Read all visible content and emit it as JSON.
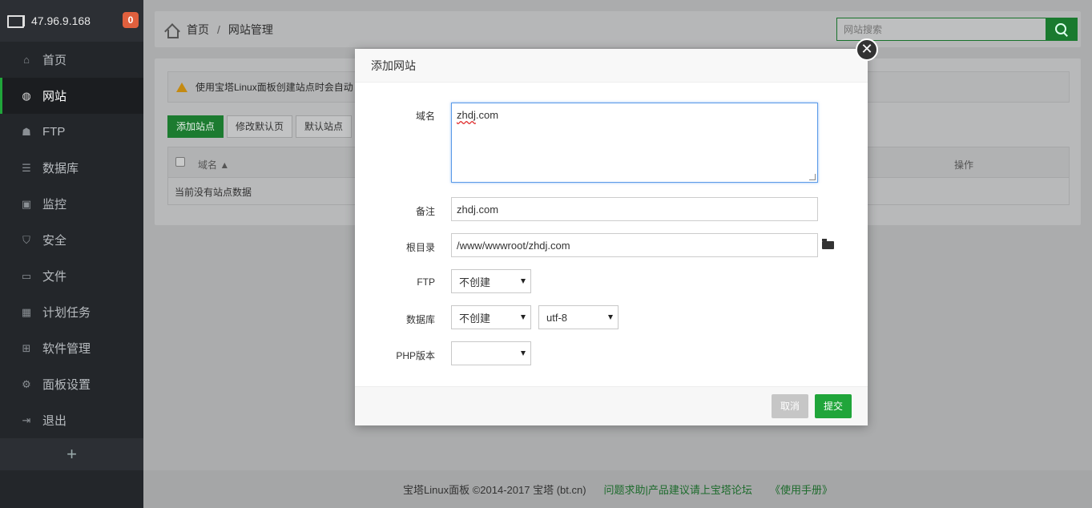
{
  "sidebar": {
    "ip": "47.96.9.168",
    "badge": "0",
    "items": [
      {
        "label": "首页",
        "icon": "home-icon"
      },
      {
        "label": "网站",
        "icon": "globe-icon"
      },
      {
        "label": "FTP",
        "icon": "ftp-icon"
      },
      {
        "label": "数据库",
        "icon": "database-icon"
      },
      {
        "label": "监控",
        "icon": "monitor-icon"
      },
      {
        "label": "安全",
        "icon": "shield-icon"
      },
      {
        "label": "文件",
        "icon": "folder-icon"
      },
      {
        "label": "计划任务",
        "icon": "calendar-icon"
      },
      {
        "label": "软件管理",
        "icon": "grid-icon"
      },
      {
        "label": "面板设置",
        "icon": "gear-icon"
      },
      {
        "label": "退出",
        "icon": "logout-icon"
      }
    ],
    "add": "+"
  },
  "header": {
    "breadcrumb_home": "首页",
    "breadcrumb_sep": "/",
    "breadcrumb_current": "网站管理",
    "search_placeholder": "网站搜索"
  },
  "panel": {
    "warning": "使用宝塔Linux面板创建站点时会自动",
    "buttons": {
      "add_site": "添加站点",
      "modify_default": "修改默认页",
      "default_site": "默认站点"
    },
    "table": {
      "col_domain": "域名 ▲",
      "col_ops": "操作",
      "empty": "当前没有站点数据"
    }
  },
  "footer": {
    "copyright": "宝塔Linux面板 ©2014-2017 宝塔 (bt.cn)",
    "forum_link": "问题求助|产品建议请上宝塔论坛",
    "manual_link": "《使用手册》"
  },
  "modal": {
    "title": "添加网站",
    "close": "✕",
    "labels": {
      "domain": "域名",
      "remark": "备注",
      "root": "根目录",
      "ftp": "FTP",
      "db": "数据库",
      "php": "PHP版本"
    },
    "domain_value_a": "zhdj",
    "domain_value_b": ".com",
    "remark_value": "zhdj.com",
    "root_value": "/www/wwwroot/zhdj.com",
    "ftp_value": "不创建",
    "db_value": "不创建",
    "charset_value": "utf-8",
    "php_value": "",
    "cancel": "取消",
    "submit": "提交"
  },
  "colors": {
    "accent": "#20a53a",
    "sidebar_bg": "#23262a",
    "badge": "#e0603e"
  }
}
